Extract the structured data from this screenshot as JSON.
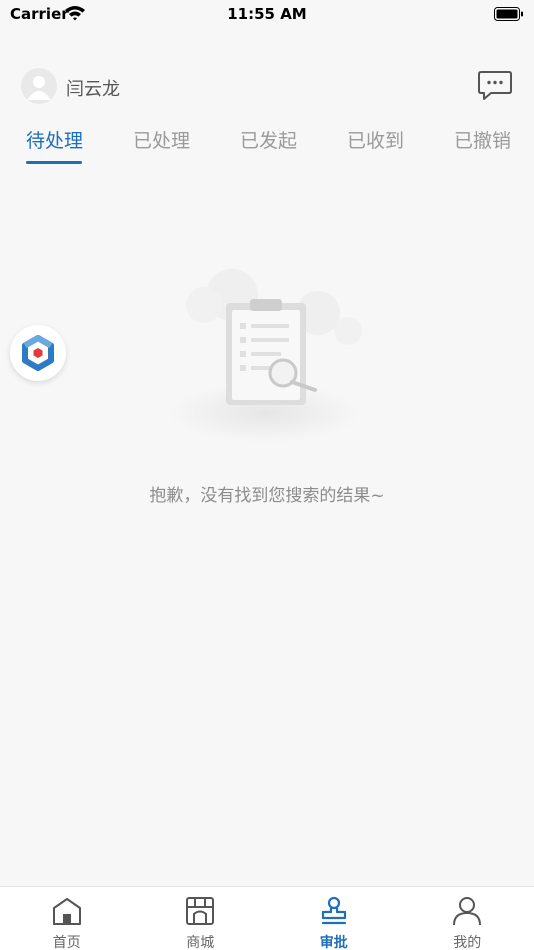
{
  "status_bar": {
    "carrier": "Carrier",
    "time": "11:55 AM"
  },
  "header": {
    "username": "闫云龙"
  },
  "tabs": [
    {
      "label": "待处理",
      "active": true
    },
    {
      "label": "已处理",
      "active": false
    },
    {
      "label": "已发起",
      "active": false
    },
    {
      "label": "已收到",
      "active": false
    },
    {
      "label": "已撤销",
      "active": false
    }
  ],
  "empty_state": {
    "message": "抱歉，没有找到您搜索的结果~"
  },
  "bottom_nav": [
    {
      "label": "首页",
      "icon": "home-icon",
      "active": false
    },
    {
      "label": "商城",
      "icon": "store-icon",
      "active": false
    },
    {
      "label": "审批",
      "icon": "stamp-icon",
      "active": true
    },
    {
      "label": "我的",
      "icon": "user-icon",
      "active": false
    }
  ],
  "colors": {
    "accent": "#1f6fb8",
    "background": "#f7f7f7",
    "inactive_tab": "#9a9a9a"
  }
}
